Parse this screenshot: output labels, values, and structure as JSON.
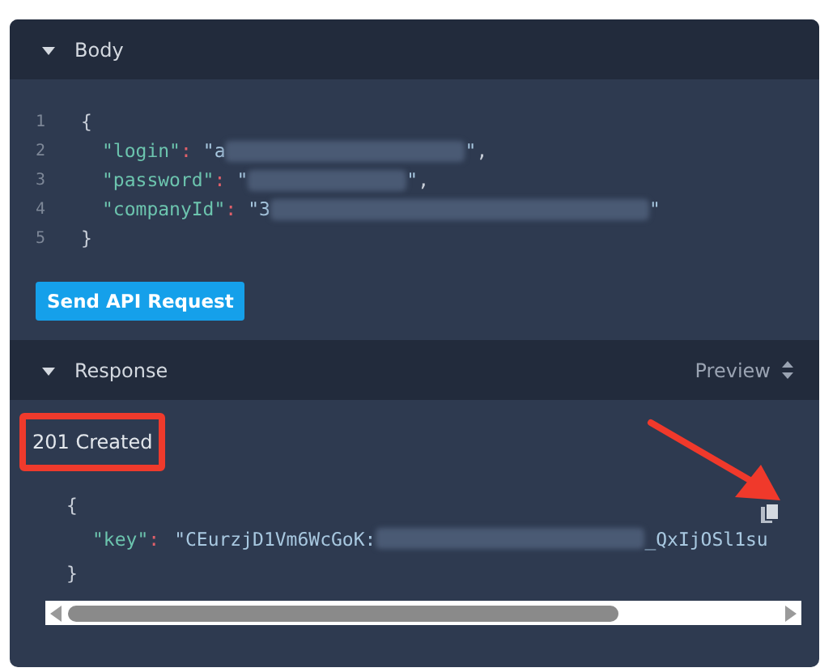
{
  "body_panel": {
    "title": "Body",
    "expanded": true,
    "code_lines": [
      {
        "number": "1",
        "parts": [
          {
            "kind": "punct",
            "text": "{"
          }
        ]
      },
      {
        "number": "2",
        "parts": [
          {
            "kind": "key",
            "text": "\"login\""
          },
          {
            "kind": "colon",
            "text": ":"
          },
          {
            "kind": "string",
            "text": "\"a"
          },
          {
            "kind": "redacted"
          },
          {
            "kind": "string",
            "text": "\""
          },
          {
            "kind": "punct",
            "text": ","
          }
        ]
      },
      {
        "number": "3",
        "parts": [
          {
            "kind": "key",
            "text": "\"password\""
          },
          {
            "kind": "colon",
            "text": ":"
          },
          {
            "kind": "string",
            "text": "\""
          },
          {
            "kind": "redacted"
          },
          {
            "kind": "string",
            "text": "\""
          },
          {
            "kind": "punct",
            "text": ","
          }
        ]
      },
      {
        "number": "4",
        "parts": [
          {
            "kind": "key",
            "text": "\"companyId\""
          },
          {
            "kind": "colon",
            "text": ":"
          },
          {
            "kind": "string",
            "text": "\"3"
          },
          {
            "kind": "redacted"
          },
          {
            "kind": "string",
            "text": "\""
          }
        ]
      },
      {
        "number": "5",
        "parts": [
          {
            "kind": "punct",
            "text": "}"
          }
        ]
      }
    ],
    "button": "Send API Request"
  },
  "response_panel": {
    "title": "Response",
    "expanded": true,
    "view_select": "Preview",
    "status": "201 Created",
    "code_lines": [
      {
        "parts": [
          {
            "kind": "punct",
            "text": "{"
          }
        ]
      },
      {
        "parts": [
          {
            "kind": "key",
            "text": "\"key\""
          },
          {
            "kind": "colon",
            "text": ":"
          },
          {
            "kind": "string",
            "text": "\"CEurzjD1Vm6WcGoK:"
          },
          {
            "kind": "redacted"
          },
          {
            "kind": "string",
            "text": "_QxIjOSl1su"
          }
        ]
      },
      {
        "parts": [
          {
            "kind": "punct",
            "text": "}"
          }
        ]
      }
    ]
  }
}
